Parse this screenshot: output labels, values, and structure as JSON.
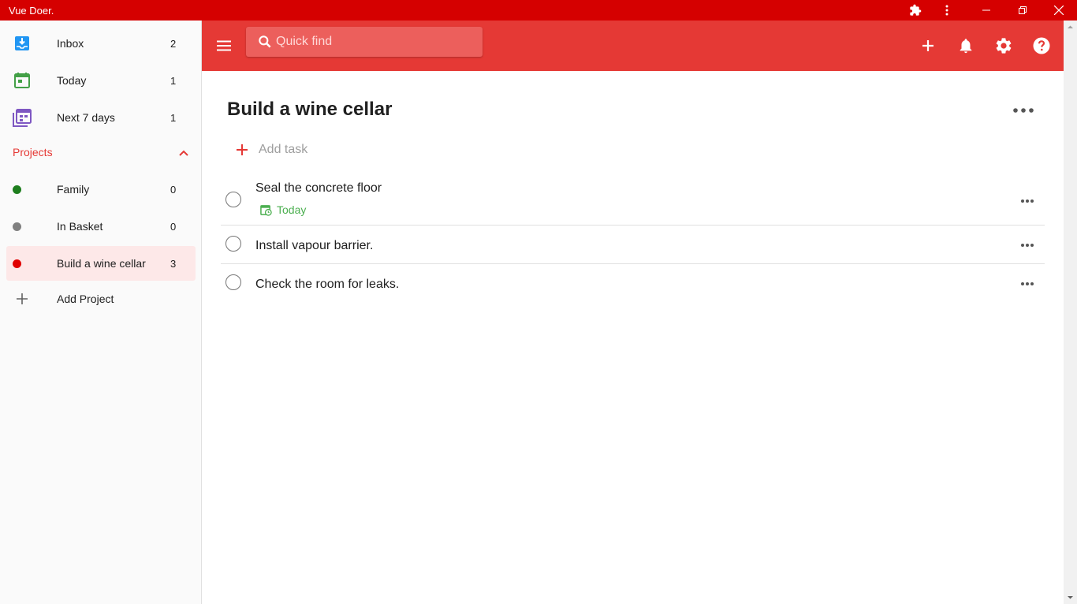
{
  "window": {
    "title": "Vue Doer."
  },
  "sidebar": {
    "items": [
      {
        "label": "Inbox",
        "count": "2"
      },
      {
        "label": "Today",
        "count": "1"
      },
      {
        "label": "Next 7 days",
        "count": "1"
      }
    ],
    "projects_header": "Projects",
    "projects": [
      {
        "label": "Family",
        "count": "0",
        "color": "#1e7e1e"
      },
      {
        "label": "In Basket",
        "count": "0",
        "color": "#808080"
      },
      {
        "label": "Build a wine cellar",
        "count": "3",
        "color": "#e00000"
      }
    ],
    "add_project": "Add Project"
  },
  "topbar": {
    "search_placeholder": "Quick find",
    "accent": "#e53935"
  },
  "main": {
    "title": "Build a wine cellar",
    "add_task_label": "Add task",
    "tasks": [
      {
        "text": "Seal the concrete floor",
        "due": "Today"
      },
      {
        "text": "Install vapour barrier."
      },
      {
        "text": "Check the room for leaks."
      }
    ]
  }
}
